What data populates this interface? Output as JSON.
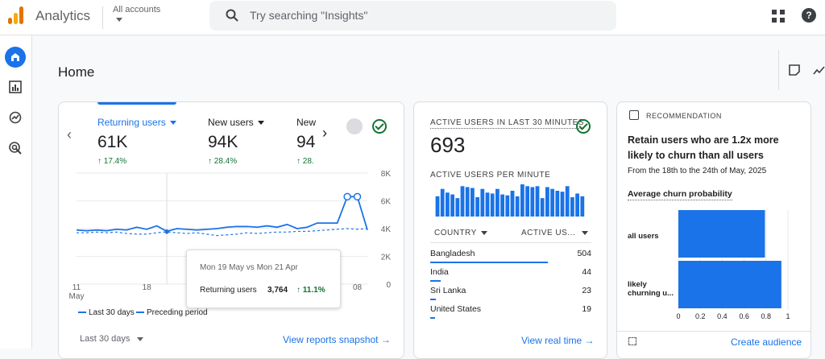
{
  "header": {
    "app_title": "Analytics",
    "account_label": "All accounts",
    "search_placeholder": "Try searching \"Insights\""
  },
  "page": {
    "title": "Home"
  },
  "overview_card": {
    "metrics": [
      {
        "label": "Returning users",
        "value": "61K",
        "change": "17.4%",
        "active": true
      },
      {
        "label": "New users",
        "value": "94K",
        "change": "28.4%",
        "active": false
      },
      {
        "label": "New",
        "value": "94",
        "change": "28.",
        "active": false
      }
    ],
    "chart_data": {
      "type": "line",
      "x_tick_labels": [
        "11\nMay",
        "18",
        "25",
        "01",
        "08"
      ],
      "y_ticks": [
        "8K",
        "6K",
        "4K",
        "2K",
        "0"
      ],
      "ylim": [
        0,
        8000
      ],
      "series": [
        {
          "name": "Last 30 days",
          "values": [
            3900,
            3850,
            3900,
            3850,
            3950,
            3900,
            4100,
            3950,
            4200,
            3800,
            4000,
            3950,
            3900,
            3950,
            4000,
            4100,
            4150,
            4150,
            4100,
            4200,
            4100,
            4300,
            4000,
            4100,
            4400,
            4400,
            4400,
            6300,
            6300,
            3900
          ]
        },
        {
          "name": "Preceding period",
          "values": [
            3700,
            3700,
            3750,
            3700,
            3750,
            3650,
            3600,
            3600,
            3700,
            3764,
            3700,
            3650,
            3700,
            3600,
            3500,
            3550,
            3600,
            3700,
            3650,
            3700,
            3750,
            3750,
            3800,
            3800,
            3850,
            3900,
            3950,
            4000,
            3950,
            4000
          ]
        }
      ]
    },
    "tooltip": {
      "title": "Mon 19 May vs Mon 21 Apr",
      "label": "Returning users",
      "value": "3,764",
      "change": "11.1%"
    },
    "legend": {
      "current": "Last 30 days",
      "previous": "Preceding period"
    },
    "date_range": "Last 30 days",
    "link": "View reports snapshot"
  },
  "realtime_card": {
    "title": "ACTIVE USERS IN LAST 30 MINUTES",
    "value": "693",
    "per_minute_label": "ACTIVE USERS PER MINUTE",
    "chart_data": {
      "type": "bar",
      "values": [
        22,
        30,
        26,
        24,
        20,
        33,
        32,
        31,
        21,
        30,
        26,
        25,
        30,
        24,
        23,
        28,
        22,
        35,
        33,
        32,
        33,
        20,
        32,
        30,
        28,
        27,
        33,
        21,
        25,
        22
      ]
    },
    "col_country": "COUNTRY",
    "col_users": "ACTIVE US...",
    "rows": [
      {
        "country": "Bangladesh",
        "count": "504",
        "share": 0.73
      },
      {
        "country": "India",
        "count": "44",
        "share": 0.064
      },
      {
        "country": "Sri Lanka",
        "count": "23",
        "share": 0.034
      },
      {
        "country": "United States",
        "count": "19",
        "share": 0.028
      }
    ],
    "link": "View real time"
  },
  "recommendation_card": {
    "header": "RECOMMENDATION",
    "title": "Retain users who are 1.2x more likely to churn than all users",
    "date_range": "From the 18th to the 24th of May, 2025",
    "chart_data": {
      "type": "bar",
      "title": "Average churn probability",
      "categories": [
        "all users",
        "likely churning u..."
      ],
      "values": [
        0.79,
        0.94
      ],
      "xlim": [
        0,
        1
      ],
      "x_ticks": [
        "0",
        "0.2",
        "0.4",
        "0.6",
        "0.8",
        "1"
      ]
    },
    "link": "Create audience"
  },
  "colors": {
    "accent": "#1a73e8",
    "positive": "#137333"
  }
}
